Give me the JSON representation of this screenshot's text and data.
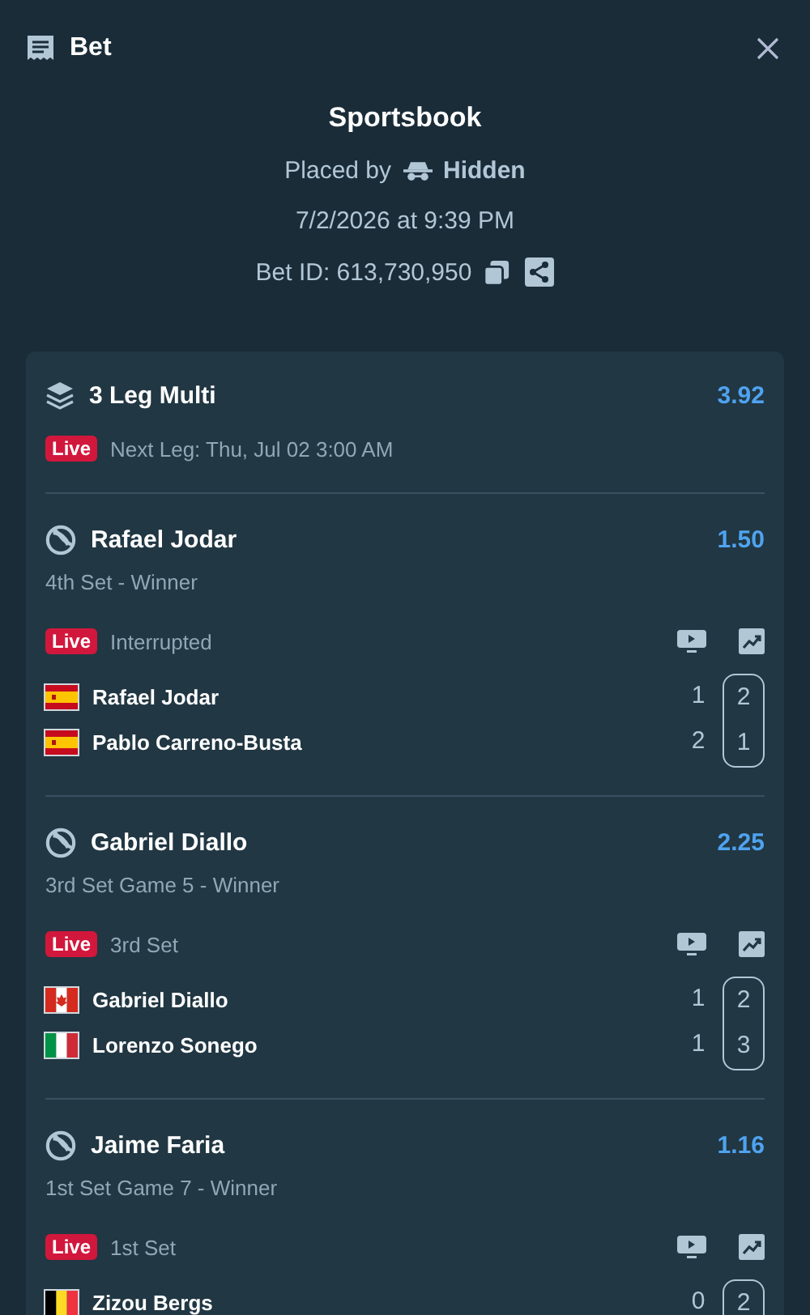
{
  "header": {
    "title": "Bet"
  },
  "summary": {
    "source": "Sportsbook",
    "placed_by_label": "Placed by",
    "placed_by_name": "Hidden",
    "placed_at": "7/2/2026 at 9:39 PM",
    "bet_id": "Bet ID: 613,730,950"
  },
  "multi": {
    "title": "3 Leg Multi",
    "odds": "3.92",
    "badge": "Live",
    "status": "Next Leg: Thu, Jul 02 3:00 AM"
  },
  "legs": [
    {
      "selection": "Rafael Jodar",
      "odds": "1.50",
      "market": "4th Set - Winner",
      "badge": "Live",
      "status": "Interrupted",
      "players": [
        {
          "name": "Rafael Jodar",
          "kind": "spain",
          "sets": "1",
          "games": "2"
        },
        {
          "name": "Pablo Carreno-Busta",
          "kind": "spain",
          "sets": "2",
          "games": "1"
        }
      ]
    },
    {
      "selection": "Gabriel Diallo",
      "odds": "2.25",
      "market": "3rd Set Game 5 - Winner",
      "badge": "Live",
      "status": "3rd Set",
      "players": [
        {
          "name": "Gabriel Diallo",
          "kind": "canada",
          "sets": "1",
          "games": "2"
        },
        {
          "name": "Lorenzo Sonego",
          "kind": "italy",
          "sets": "1",
          "games": "3"
        }
      ]
    },
    {
      "selection": "Jaime Faria",
      "odds": "1.16",
      "market": "1st Set Game 7 - Winner",
      "badge": "Live",
      "status": "1st Set",
      "players": [
        {
          "name": "Zizou Bergs",
          "kind": "belgium",
          "sets": "0",
          "games": "2"
        }
      ]
    }
  ]
}
